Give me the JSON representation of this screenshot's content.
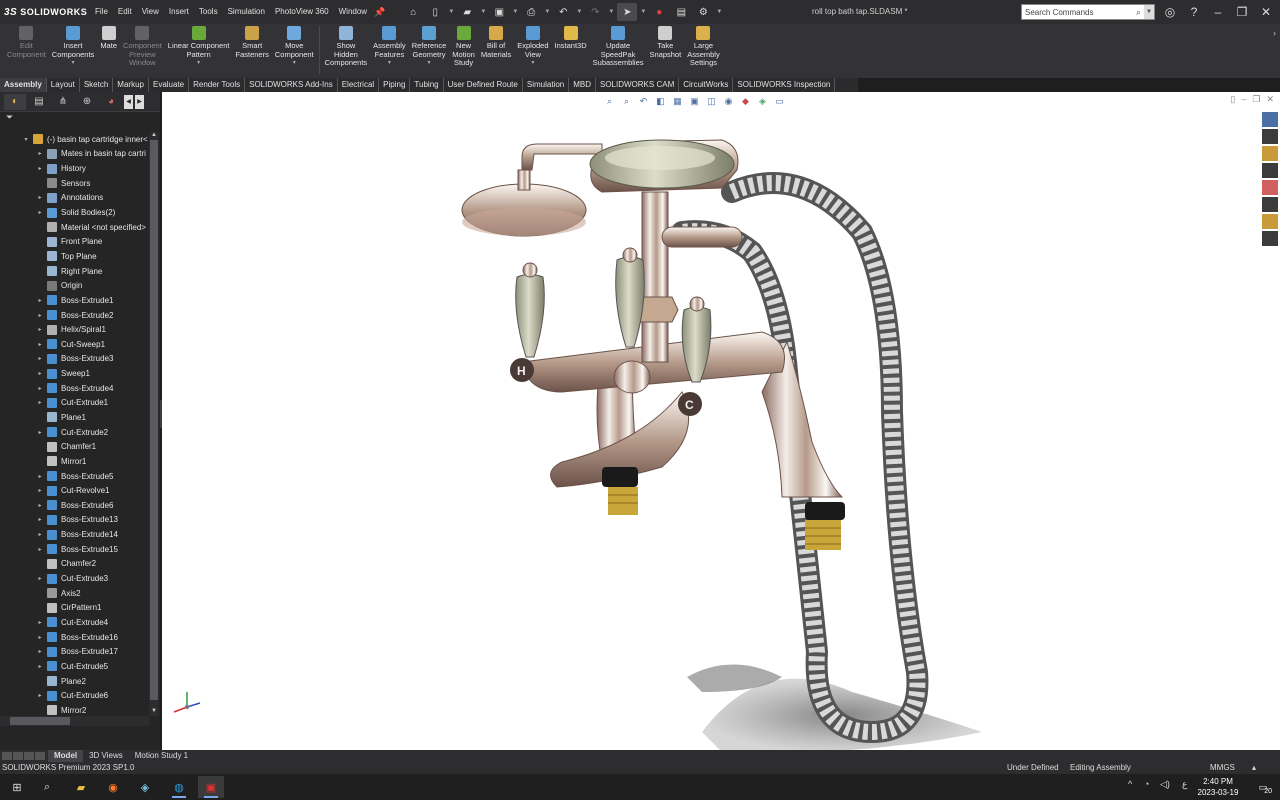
{
  "app": {
    "logo_ds": "3S",
    "logo_text": "SOLIDWORKS",
    "document_title": "roll top bath tap.SLDASM *",
    "search_placeholder": "Search Commands"
  },
  "menus": [
    "File",
    "Edit",
    "View",
    "Insert",
    "Tools",
    "Simulation",
    "PhotoView 360",
    "Window"
  ],
  "ribbon": [
    {
      "label": "Edit\nComponent",
      "disabled": true,
      "color": "#9b9b9b"
    },
    {
      "label": "Insert\nComponents",
      "disabled": false,
      "color": "#5b9bd5",
      "caret": true
    },
    {
      "label": "Mate",
      "disabled": false,
      "color": "#cfcfcf"
    },
    {
      "label": "Component\nPreview\nWindow",
      "disabled": true,
      "color": "#9b9b9b"
    },
    {
      "label": "Linear Component\nPattern",
      "disabled": false,
      "color": "#6aaa3a",
      "caret": true
    },
    {
      "label": "Smart\nFasteners",
      "disabled": false,
      "color": "#c9a24a"
    },
    {
      "label": "Move\nComponent",
      "disabled": false,
      "color": "#6fa8dc",
      "caret": true
    },
    {
      "label": "Show\nHidden\nComponents",
      "disabled": false,
      "color": "#8fb3d9",
      "sep": true
    },
    {
      "label": "Assembly\nFeatures",
      "disabled": false,
      "color": "#5b9bd5",
      "caret": true
    },
    {
      "label": "Reference\nGeometry",
      "disabled": false,
      "color": "#5ba0d0",
      "caret": true
    },
    {
      "label": "New\nMotion\nStudy",
      "disabled": false,
      "color": "#6aaa3a"
    },
    {
      "label": "Bill of\nMaterials",
      "disabled": false,
      "color": "#d7a94b"
    },
    {
      "label": "Exploded\nView",
      "disabled": false,
      "color": "#5b9bd5",
      "caret": true
    },
    {
      "label": "Instant3D",
      "disabled": false,
      "color": "#e0b84a"
    },
    {
      "label": "Update\nSpeedPak\nSubassemblies",
      "disabled": false,
      "color": "#5b9bd5"
    },
    {
      "label": "Take\nSnapshot",
      "disabled": false,
      "color": "#cfcfcf"
    },
    {
      "label": "Large\nAssembly\nSettings",
      "disabled": false,
      "color": "#d9b04a"
    }
  ],
  "tabs": [
    "Assembly",
    "Layout",
    "Sketch",
    "Markup",
    "Evaluate",
    "Render Tools",
    "SOLIDWORKS Add-Ins",
    "Electrical",
    "Piping",
    "Tubing",
    "User Defined Route",
    "Simulation",
    "MBD",
    "SOLIDWORKS CAM",
    "CircuitWorks",
    "SOLIDWORKS Inspection"
  ],
  "feature_tree": [
    {
      "label": "(-) basin tap cartridge inner<",
      "icon": "#d8a53a",
      "exp": "▾",
      "indent": 0
    },
    {
      "label": "Mates in basin tap cartri",
      "icon": "#8aa0b8",
      "exp": "▸",
      "indent": 1
    },
    {
      "label": "History",
      "icon": "#7ea0c8",
      "exp": "▸",
      "indent": 1
    },
    {
      "label": "Sensors",
      "icon": "#8a8a8a",
      "exp": "",
      "indent": 1
    },
    {
      "label": "Annotations",
      "icon": "#7ea0c8",
      "exp": "▸",
      "indent": 1
    },
    {
      "label": "Solid Bodies(2)",
      "icon": "#5b9bd5",
      "exp": "▸",
      "indent": 1
    },
    {
      "label": "Material <not specified>",
      "icon": "#b0b0b0",
      "exp": "",
      "indent": 1
    },
    {
      "label": "Front Plane",
      "icon": "#9ab6d0",
      "exp": "",
      "indent": 1
    },
    {
      "label": "Top Plane",
      "icon": "#9ab6d0",
      "exp": "",
      "indent": 1
    },
    {
      "label": "Right Plane",
      "icon": "#9ab6d0",
      "exp": "",
      "indent": 1
    },
    {
      "label": "Origin",
      "icon": "#7a7a7a",
      "exp": "",
      "indent": 1
    },
    {
      "label": "Boss-Extrude1",
      "icon": "#4a8fd0",
      "exp": "▸",
      "indent": 1
    },
    {
      "label": "Boss-Extrude2",
      "icon": "#4a8fd0",
      "exp": "▸",
      "indent": 1
    },
    {
      "label": "Helix/Spiral1",
      "icon": "#b0b0b0",
      "exp": "▸",
      "indent": 1
    },
    {
      "label": "Cut-Sweep1",
      "icon": "#4a8fd0",
      "exp": "▸",
      "indent": 1
    },
    {
      "label": "Boss-Extrude3",
      "icon": "#4a8fd0",
      "exp": "▸",
      "indent": 1
    },
    {
      "label": "Sweep1",
      "icon": "#4a8fd0",
      "exp": "▸",
      "indent": 1
    },
    {
      "label": "Boss-Extrude4",
      "icon": "#4a8fd0",
      "exp": "▸",
      "indent": 1
    },
    {
      "label": "Cut-Extrude1",
      "icon": "#4a8fd0",
      "exp": "▸",
      "indent": 1
    },
    {
      "label": "Plane1",
      "icon": "#9ab6d0",
      "exp": "",
      "indent": 1
    },
    {
      "label": "Cut-Extrude2",
      "icon": "#4a8fd0",
      "exp": "▸",
      "indent": 1
    },
    {
      "label": "Chamfer1",
      "icon": "#c0c0c0",
      "exp": "",
      "indent": 1
    },
    {
      "label": "Mirror1",
      "icon": "#c0c0c0",
      "exp": "",
      "indent": 1
    },
    {
      "label": "Boss-Extrude5",
      "icon": "#4a8fd0",
      "exp": "▸",
      "indent": 1
    },
    {
      "label": "Cut-Revolve1",
      "icon": "#4a8fd0",
      "exp": "▸",
      "indent": 1
    },
    {
      "label": "Boss-Extrude6",
      "icon": "#4a8fd0",
      "exp": "▸",
      "indent": 1
    },
    {
      "label": "Boss-Extrude13",
      "icon": "#4a8fd0",
      "exp": "▸",
      "indent": 1
    },
    {
      "label": "Boss-Extrude14",
      "icon": "#4a8fd0",
      "exp": "▸",
      "indent": 1
    },
    {
      "label": "Boss-Extrude15",
      "icon": "#4a8fd0",
      "exp": "▸",
      "indent": 1
    },
    {
      "label": "Chamfer2",
      "icon": "#c0c0c0",
      "exp": "",
      "indent": 1
    },
    {
      "label": "Cut-Extrude3",
      "icon": "#4a8fd0",
      "exp": "▸",
      "indent": 1
    },
    {
      "label": "Axis2",
      "icon": "#9a9a9a",
      "exp": "",
      "indent": 1
    },
    {
      "label": "CirPattern1",
      "icon": "#c0c0c0",
      "exp": "",
      "indent": 1
    },
    {
      "label": "Cut-Extrude4",
      "icon": "#4a8fd0",
      "exp": "▸",
      "indent": 1
    },
    {
      "label": "Boss-Extrude16",
      "icon": "#4a8fd0",
      "exp": "▸",
      "indent": 1
    },
    {
      "label": "Boss-Extrude17",
      "icon": "#4a8fd0",
      "exp": "▸",
      "indent": 1
    },
    {
      "label": "Cut-Extrude5",
      "icon": "#4a8fd0",
      "exp": "▸",
      "indent": 1
    },
    {
      "label": "Plane2",
      "icon": "#9ab6d0",
      "exp": "",
      "indent": 1
    },
    {
      "label": "Cut-Extrude6",
      "icon": "#4a8fd0",
      "exp": "▸",
      "indent": 1
    },
    {
      "label": "Mirror2",
      "icon": "#c0c0c0",
      "exp": "",
      "indent": 1
    }
  ],
  "bottom_tabs": [
    "Model",
    "3D Views",
    "Motion Study 1"
  ],
  "status": {
    "left": "SOLIDWORKS Premium 2023 SP1.0",
    "defined": "Under Defined",
    "mode": "Editing Assembly",
    "units": "MMGS"
  },
  "taskbar": {
    "time": "2:40 PM",
    "date": "2023-03-19",
    "notif_count": "20",
    "lang": "ع"
  },
  "tap_letters": {
    "hot": "H",
    "cold": "C"
  },
  "colors": {
    "accent": "#4a8fd0",
    "background": "#1e1e1e"
  }
}
